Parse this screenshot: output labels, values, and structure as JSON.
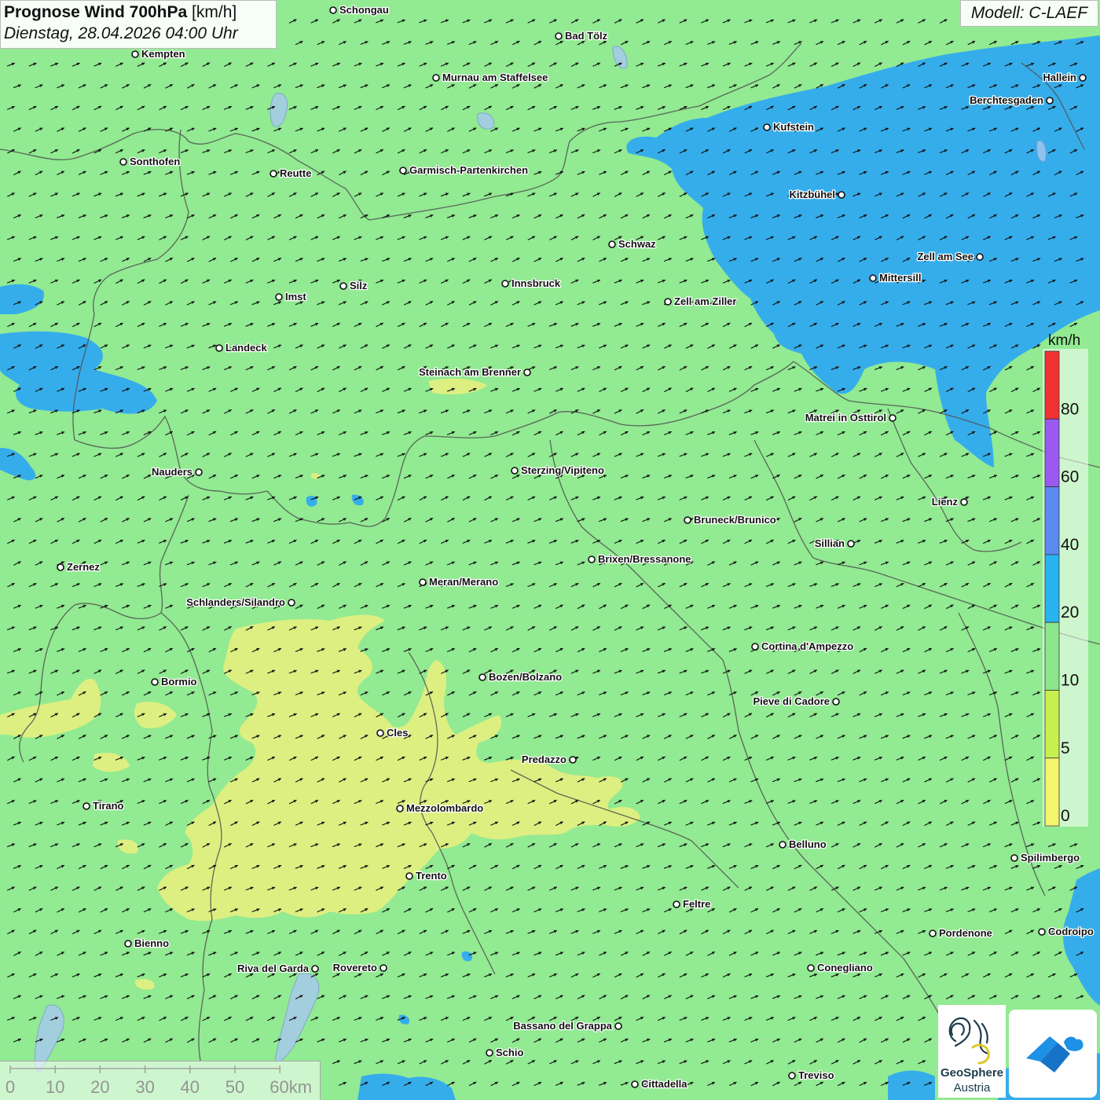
{
  "title": {
    "name": "Prognose Wind 700hPa",
    "unit": "[km/h]",
    "datetime": "Dienstag, 28.04.2026 04:00 Uhr"
  },
  "model": "Modell: C-LAEF",
  "legend": {
    "unit": "km/h",
    "labels": [
      "80",
      "60",
      "40",
      "20",
      "10",
      "5",
      "0"
    ],
    "colors": [
      "#f03232",
      "#9a5af0",
      "#5a8cf0",
      "#28b4f0",
      "#8ce68c",
      "#c8f050",
      "#f5f56e"
    ]
  },
  "scale_bar": {
    "labels": [
      "0",
      "10",
      "20",
      "30",
      "40",
      "50",
      "60km"
    ]
  },
  "logos": {
    "geosphere_line1": "GeoSphere",
    "geosphere_line2": "Austria"
  },
  "map_colors": {
    "background": "#92ea92",
    "strong_wind": "#32aaf0",
    "weak_wind": "#e6f080",
    "border": "#555555",
    "arrow": "#111111"
  },
  "wind": {
    "direction": "west-southwest flow toward east-northeast"
  },
  "cities": [
    {
      "name": "Schongau",
      "label_side": "right"
    },
    {
      "name": "Bad Tölz",
      "label_side": "right"
    },
    {
      "name": "Kempten",
      "label_side": "right"
    },
    {
      "name": "Murnau am Staffelsee",
      "label_side": "right"
    },
    {
      "name": "Hallein",
      "label_side": "left"
    },
    {
      "name": "Berchtesgaden",
      "label_side": "left"
    },
    {
      "name": "Kufstein",
      "label_side": "right"
    },
    {
      "name": "Sonthofen",
      "label_side": "right"
    },
    {
      "name": "Reutte",
      "label_side": "right"
    },
    {
      "name": "Garmisch-Partenkirchen",
      "label_side": "right"
    },
    {
      "name": "Kitzbühel",
      "label_side": "left"
    },
    {
      "name": "Schwaz",
      "label_side": "right"
    },
    {
      "name": "Zell am See",
      "label_side": "left"
    },
    {
      "name": "Mittersill",
      "label_side": "right"
    },
    {
      "name": "Innsbruck",
      "label_side": "right"
    },
    {
      "name": "Silz",
      "label_side": "right"
    },
    {
      "name": "Imst",
      "label_side": "right"
    },
    {
      "name": "Zell am Ziller",
      "label_side": "right"
    },
    {
      "name": "Landeck",
      "label_side": "right"
    },
    {
      "name": "Steinach am Brenner",
      "label_side": "left"
    },
    {
      "name": "Matrei in Osttirol",
      "label_side": "left"
    },
    {
      "name": "Nauders",
      "label_side": "left"
    },
    {
      "name": "Sterzing/Vipiteno",
      "label_side": "right"
    },
    {
      "name": "Lienz",
      "label_side": "left"
    },
    {
      "name": "Bruneck/Brunico",
      "label_side": "right"
    },
    {
      "name": "Sillian",
      "label_side": "left"
    },
    {
      "name": "Zernez",
      "label_side": "right"
    },
    {
      "name": "Brixen/Bressanone",
      "label_side": "right"
    },
    {
      "name": "Meran/Merano",
      "label_side": "right"
    },
    {
      "name": "Schlanders/Silandro",
      "label_side": "left"
    },
    {
      "name": "Cortina d'Ampezzo",
      "label_side": "right"
    },
    {
      "name": "Bozen/Bolzano",
      "label_side": "right"
    },
    {
      "name": "Bormio",
      "label_side": "right"
    },
    {
      "name": "Pieve di Cadore",
      "label_side": "left"
    },
    {
      "name": "Cles",
      "label_side": "right"
    },
    {
      "name": "Predazzo",
      "label_side": "left"
    },
    {
      "name": "Tirano",
      "label_side": "right"
    },
    {
      "name": "Mezzolombardo",
      "label_side": "right"
    },
    {
      "name": "Belluno",
      "label_side": "right"
    },
    {
      "name": "Spilimbergo",
      "label_side": "right"
    },
    {
      "name": "Trento",
      "label_side": "right"
    },
    {
      "name": "Feltre",
      "label_side": "right"
    },
    {
      "name": "Pordenone",
      "label_side": "right"
    },
    {
      "name": "Codroipo",
      "label_side": "right"
    },
    {
      "name": "Bienno",
      "label_side": "right"
    },
    {
      "name": "Riva del Garda",
      "label_side": "left"
    },
    {
      "name": "Rovereto",
      "label_side": "left"
    },
    {
      "name": "Conegliano",
      "label_side": "right"
    },
    {
      "name": "Bassano del Grappa",
      "label_side": "left"
    },
    {
      "name": "Schio",
      "label_side": "right"
    },
    {
      "name": "Treviso",
      "label_side": "right"
    },
    {
      "name": "Cittadella",
      "label_side": "right"
    }
  ]
}
